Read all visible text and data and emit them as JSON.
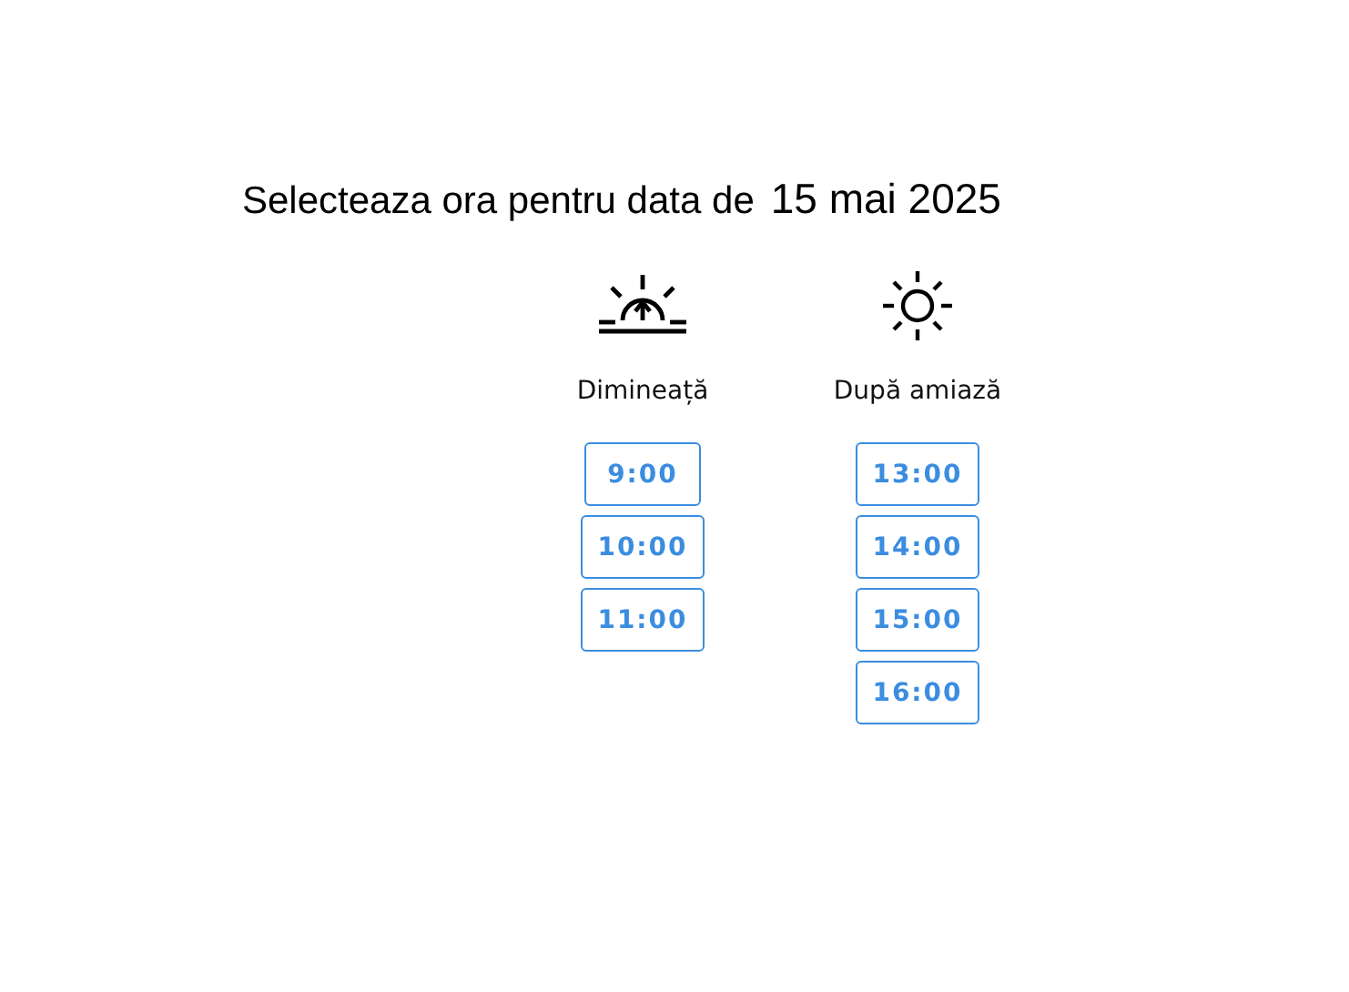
{
  "title": {
    "text": "Selecteaza ora pentru data de",
    "date": "15 mai 2025"
  },
  "periods": [
    {
      "kind": "sunrise",
      "label": "Dimineață",
      "slots": [
        "9:00",
        "10:00",
        "11:00"
      ]
    },
    {
      "kind": "sun",
      "label": "După amiază",
      "slots": [
        "13:00",
        "14:00",
        "15:00",
        "16:00"
      ]
    }
  ]
}
